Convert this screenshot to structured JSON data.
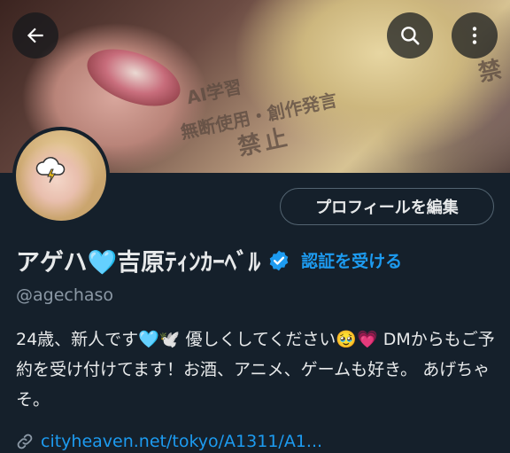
{
  "banner": {
    "watermark_lines": [
      "AI学習",
      "無断使用・創作発言",
      "禁止",
      "禁"
    ]
  },
  "header": {
    "back_icon": "arrow-left-icon",
    "search_icon": "search-icon",
    "more_icon": "more-vertical-icon"
  },
  "profile": {
    "edit_button_label": "プロフィールを編集",
    "display_name": "アゲハ🩵吉原ﾃｨﾝｶｰﾍﾞﾙ",
    "verified_icon": "verified-badge-icon",
    "get_verified_label": "認証を受ける",
    "handle": "@agechaso",
    "bio": "24歳、新人です🩵🕊️ 優しくしてください🥹💗 DMからもご予約を受け付けてます！お酒、アニメ、ゲームも好き。 あげちゃそ。",
    "link_icon": "link-icon",
    "link_text": "cityheaven.net/tokyo/A1311/A1..."
  },
  "colors": {
    "background": "#15202b",
    "accent": "#1d9bf0",
    "secondary_text": "#8b98a5"
  }
}
